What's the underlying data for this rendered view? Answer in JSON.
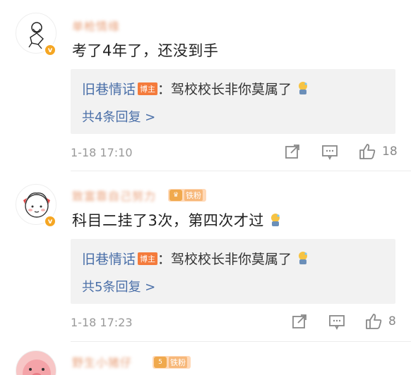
{
  "comments": [
    {
      "username": "单枪情缘",
      "text": "考了4年了，还没到手",
      "reply": {
        "author": "旧巷情话",
        "tag": "博主",
        "text": "：驾校校长非你莫属了"
      },
      "more_replies": "共4条回复 >",
      "time": "1-18 17:10",
      "likes": "18"
    },
    {
      "username": "致富靠自己努力",
      "fan_level": "铁粉",
      "text": "科目二挂了3次，第四次才过",
      "reply": {
        "author": "旧巷情话",
        "tag": "博主",
        "text": "：驾校校长非你莫属了"
      },
      "more_replies": "共5条回复 >",
      "time": "1-18 17:23",
      "likes": "8"
    },
    {
      "username": "野生小猪仔",
      "fan_level": "铁粉",
      "fan_num": "5"
    }
  ],
  "colors": {
    "link": "#4a6fa8",
    "badge": "#f47b3c",
    "meta": "#999999"
  },
  "icons": [
    "forward-icon",
    "comment-icon",
    "like-icon",
    "sweat-emoji-icon",
    "verified-icon",
    "crown-icon"
  ]
}
